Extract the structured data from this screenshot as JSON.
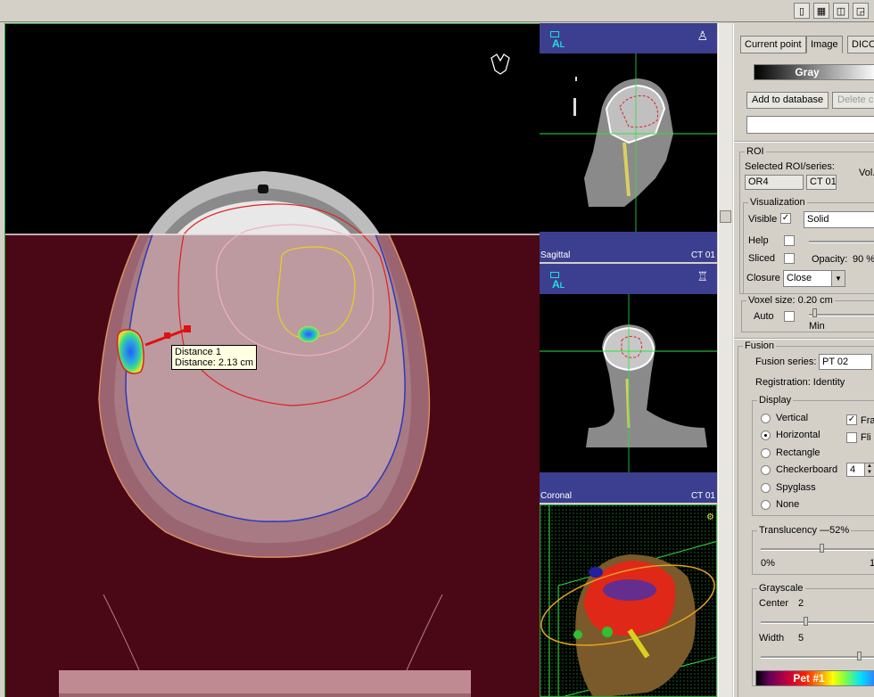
{
  "viewports": {
    "axial": {
      "measurement": {
        "title": "Distance 1",
        "value": "Distance: 2.13 cm"
      }
    },
    "sagittal": {
      "label": "Sagittal",
      "series": "CT 01",
      "orientation": "A",
      "orientation_sub": "L"
    },
    "coronal": {
      "label": "Coronal",
      "series": "CT 01",
      "orientation": "A",
      "orientation_sub": "L"
    }
  },
  "panel": {
    "tabs": [
      "Current point",
      "Image",
      "DICO"
    ],
    "lut_name": "Gray",
    "add_to_database": "Add to database",
    "delete_button": "Delete c",
    "roi": {
      "title": "ROI",
      "selected_label": "Selected ROI/series:",
      "vol_label": "Vol.",
      "roi_name": "OR4",
      "series": "CT 01",
      "visualization": {
        "title": "Visualization",
        "visible_label": "Visible",
        "visible_checked": true,
        "mode": "Solid",
        "help_label": "Help",
        "sliced_label": "Sliced",
        "opacity_label": "Opacity:",
        "opacity_value": "90 %",
        "closure_label": "Closure",
        "closure_value": "Close"
      },
      "voxel": {
        "title": "Voxel size: 0.20 cm",
        "auto_label": "Auto",
        "min_label": "Min"
      }
    },
    "fusion": {
      "title": "Fusion",
      "series_label": "Fusion series:",
      "series_value": "PT 02",
      "registration": "Registration:  Identity",
      "display": {
        "title": "Display",
        "options": [
          "Vertical",
          "Horizontal",
          "Rectangle",
          "Checkerboard",
          "Spyglass",
          "None"
        ],
        "selected": "Horizontal",
        "frame_label": "Fra",
        "frame_checked": true,
        "flip_label": "Fli",
        "checker_value": "4"
      },
      "translucency": {
        "title": "Translucency",
        "value": "52%",
        "min": "0%",
        "max": "1",
        "level": 0.52
      },
      "grayscale": {
        "title": "Grayscale",
        "center_label": "Center",
        "center_value": "2",
        "width_label": "Width",
        "width_value": "5"
      },
      "colormap": "Pet #1"
    }
  },
  "colors": {
    "viewport_header": "#3c3f8f",
    "orientation_text": "#20e0e0",
    "pet_overlay": "#4a0716",
    "frame_green": "#2fa63a"
  }
}
